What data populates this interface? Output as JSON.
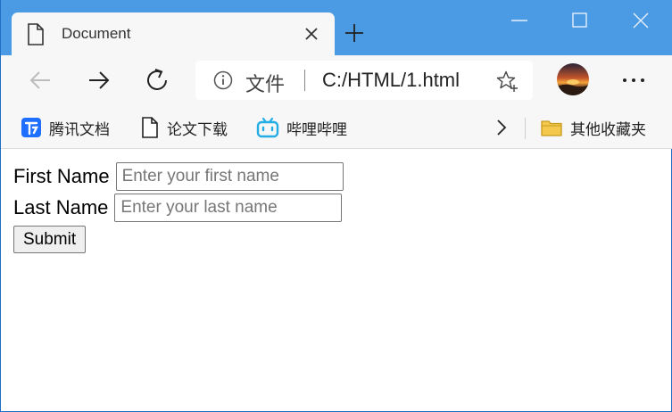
{
  "tab": {
    "title": "Document"
  },
  "address_bar": {
    "label": "文件",
    "url": "C:/HTML/1.html"
  },
  "favorites": [
    {
      "label": "腾讯文档",
      "icon": "tencent-docs-icon"
    },
    {
      "label": "论文下载",
      "icon": "document-icon"
    },
    {
      "label": "哔哩哔哩",
      "icon": "bilibili-icon"
    },
    {
      "label": "其他收藏夹",
      "icon": "folder-icon"
    }
  ],
  "form": {
    "first_name_label": "First Name",
    "first_name_placeholder": "Enter your first name",
    "last_name_label": "Last Name",
    "last_name_placeholder": "Enter your last name",
    "submit_label": "Submit"
  },
  "colors": {
    "titlebar": "#4a9be3",
    "toolbar": "#f7f7f7",
    "tencent_blue": "#1e6fff",
    "bilibili_blue": "#23ade5",
    "folder_yellow": "#f2c94c"
  }
}
